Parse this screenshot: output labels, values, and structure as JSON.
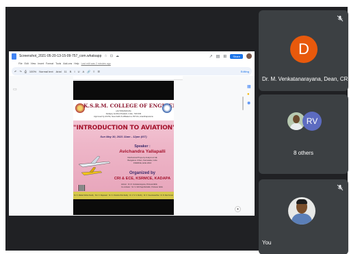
{
  "docs": {
    "filename": "Screenshot_2021-05-20-13-15-09-757_com.whatsapp",
    "menu": [
      "File",
      "Edit",
      "View",
      "Insert",
      "Format",
      "Tools",
      "Add-ons",
      "Help"
    ],
    "saved_note": "Last edit was 2 minutes ago",
    "toolbar": [
      "100%",
      "Normal text",
      "Arial",
      "11",
      "B",
      "I",
      "U",
      "A"
    ],
    "share_label": "Share",
    "editing_label": "Editing"
  },
  "poster": {
    "college": "K.S.R.M. COLLEGE OF ENGINEERING",
    "sub1": "(AUTONOMOUS)",
    "sub2": "Kadapa, Andhra Pradesh, India - 516 003",
    "sub3": "Approved by AICTE, New Delhi & Affiliated to JNTUA, Ananthapuramu",
    "title": "\"INTRODUCTION TO AVIATION\"",
    "date": "Sun May 30, 2021 11am - 12pm (IST)",
    "speaker_label": "Speaker :",
    "speaker_name": "Avichandra Yallapalli",
    "speaker_info1": "Mechanical Property Analyst at GE",
    "speaker_info2": "Bangalore Urban, Karnataka, India",
    "speaker_info3": "KSRMCE, ECE 2016",
    "organized_label": "Organized by",
    "organizer": "CRI & ECE, KSRMCE, KADAPA",
    "coord1": "Advisor : Dr. M. Venkatanarayana, Professor/ECE",
    "coord2": "Co-ordinator : Sri. S. Md Khaja Mohiddin, Professor /ECE",
    "footer": [
      "Sri. K. Madan Mohan Reddy",
      "Smt. K. Rajeswari",
      "Sri. K. Chandra Obul Reddy",
      "Dr. V. S. S. Murthy",
      "Dr. K. Sreenivasa Rao",
      "Dr. B. Ravi Kumar"
    ]
  },
  "participants": [
    {
      "name": "Dr. M. Venkatanarayana, Dean, CR...",
      "initial": "D",
      "muted": true
    },
    {
      "others_label": "8 others",
      "initials": "RV"
    },
    {
      "name": "You",
      "muted": true
    }
  ],
  "colors": {
    "meet_bg": "#202124",
    "tile_bg": "#3c4043",
    "avatar_d": "#e8590c",
    "avatar_rv": "#5c6bc0",
    "accent": "#1a73e8"
  }
}
